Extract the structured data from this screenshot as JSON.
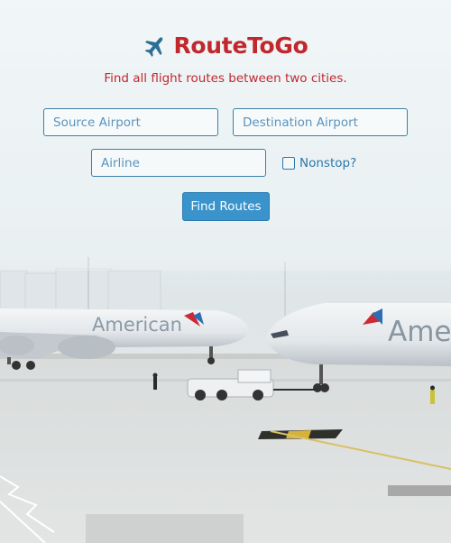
{
  "brand": {
    "name": "RouteToGo",
    "tagline": "Find all flight routes between two cities."
  },
  "search": {
    "source_placeholder": "Source Airport",
    "destination_placeholder": "Destination Airport",
    "airline_placeholder": "Airline",
    "nonstop_label": "Nonstop?",
    "submit_label": "Find Routes"
  },
  "background": {
    "plane_left_livery": "American",
    "plane_right_livery": "Ame"
  },
  "colors": {
    "brand_red": "#c0282e",
    "field_blue": "#2d78a8",
    "button_blue": "#3a93cb",
    "logo_blue": "#2b6f97"
  }
}
